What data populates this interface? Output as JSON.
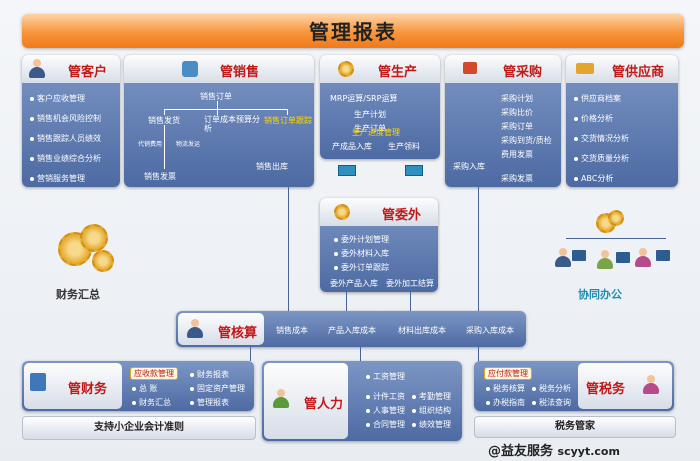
{
  "title": "管理报表",
  "kehu": {
    "title": "管客户",
    "items": [
      "客户应收管理",
      "销售机会风险控制",
      "销售跟踪人员绩效",
      "销售业绩综合分析",
      "营销服务管理"
    ]
  },
  "xiaoshou": {
    "title": "管销售",
    "top": "销售订单",
    "branches": [
      "销售发货",
      "订单成本预算分析",
      "销售订单跟踪"
    ],
    "sub": [
      "代销费用",
      "物流发运"
    ],
    "bottom": [
      "销售发票",
      "销售出库"
    ]
  },
  "shengchan": {
    "title": "管生产",
    "items": [
      "MRP运算/SRP运算",
      "生产计划",
      "生产订单",
      "生产进度管理",
      "产成品入库",
      "生产领料"
    ]
  },
  "caigou": {
    "title": "管采购",
    "items": [
      "采购计划",
      "采购比价",
      "采购订单",
      "采购到货/质检",
      "费用发票",
      "采购入库",
      "采购发票"
    ]
  },
  "gongying": {
    "title": "管供应商",
    "items": [
      "供应商档案",
      "价格分析",
      "交货情况分析",
      "交货质量分析",
      "ABC分析"
    ]
  },
  "weiwai": {
    "title": "管委外",
    "items": [
      "委外计划管理",
      "委外材料入库",
      "委外订单跟踪"
    ],
    "bottom": [
      "委外产品入库",
      "委外加工结算"
    ]
  },
  "caiwu_summary": "财务汇总",
  "collab": "协同办公",
  "hesuan": {
    "title": "管核算",
    "items": [
      "销售成本",
      "产品入库成本",
      "材料出库成本",
      "采购入库成本"
    ]
  },
  "caiwu": {
    "title": "管财务",
    "items": [
      "应收款管理",
      "财务报表",
      "总  账",
      "固定资产管理",
      "财务汇总",
      "管理报表"
    ]
  },
  "renli": {
    "title": "管人力",
    "items": [
      "工资管理",
      "计件工资",
      "考勤管理",
      "人事管理",
      "组织结构",
      "合同管理",
      "绩效管理"
    ]
  },
  "shuiwu": {
    "title": "管税务",
    "items": [
      "应付款管理",
      "税务核算",
      "税务分析",
      "办税指南",
      "税法查询"
    ]
  },
  "footer_left": "支持小企业会计准则",
  "footer_right": "税务管家",
  "brand_main": "@益友服务",
  "brand_url": "scyyt.com",
  "colors": {
    "accent": "#ef7a1a",
    "box": "#4d6aa3",
    "title_red": "#c01919"
  }
}
